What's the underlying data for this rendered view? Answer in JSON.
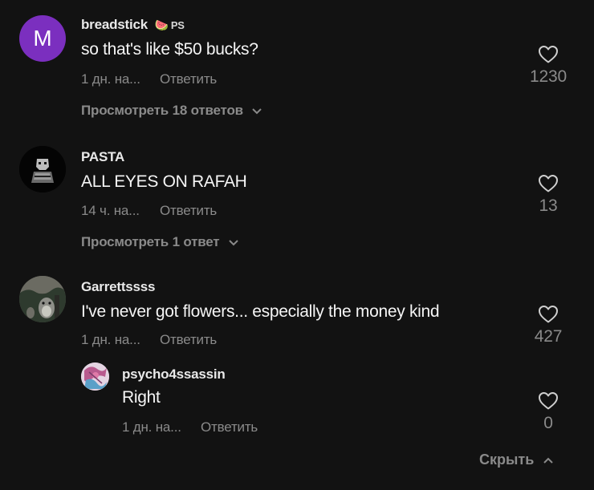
{
  "comments": [
    {
      "avatar_letter": "M",
      "avatar_color": "#7b2fbf",
      "username": "breadstick",
      "badge_emoji": "🍉",
      "badge_text": "PS",
      "text": "so that's like $50 bucks?",
      "meta": "1 дн. на...",
      "reply_label": "Ответить",
      "likes": "1230",
      "view_replies": "Просмотреть 18 ответов"
    },
    {
      "username": "PASTA",
      "text": "ALL EYES ON RAFAH",
      "meta": "14 ч. на...",
      "reply_label": "Ответить",
      "likes": "13",
      "view_replies": "Просмотреть 1 ответ"
    },
    {
      "username": "Garrettssss",
      "text": "I've never got flowers... especially the money kind",
      "meta": "1 дн. на...",
      "reply_label": "Ответить",
      "likes": "427",
      "replies": [
        {
          "username": "psycho4ssassin",
          "text": "Right",
          "meta": "1 дн. на...",
          "reply_label": "Ответить",
          "likes": "0"
        }
      ],
      "hide_label": "Скрыть"
    }
  ],
  "colors": {
    "background": "#121212",
    "muted_text": "#8a8a8a",
    "primary_text": "#f5f5f5"
  },
  "icons": {
    "like": "heart-outline-icon",
    "expand": "chevron-down-icon",
    "collapse": "chevron-up-icon"
  }
}
